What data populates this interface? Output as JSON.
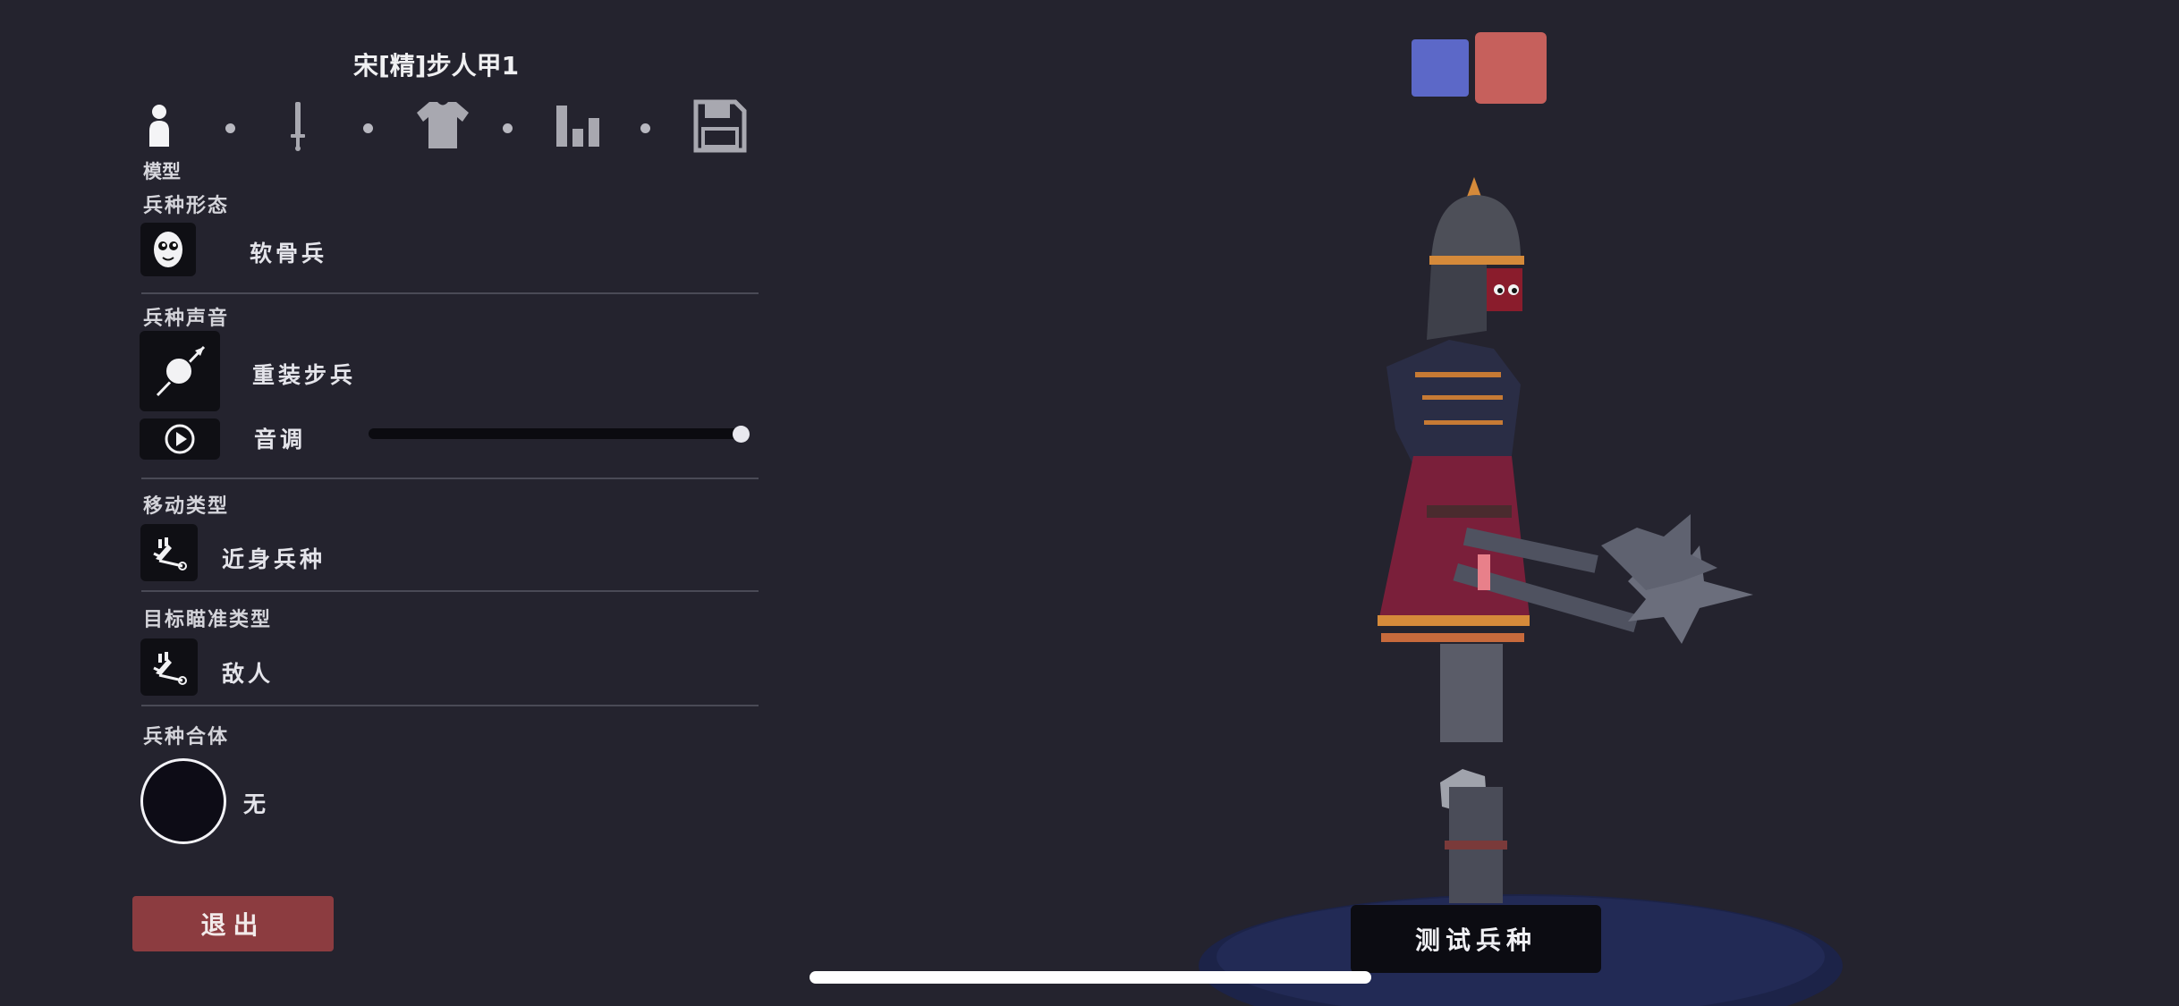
{
  "unit": {
    "name": "宋[精]步人甲1"
  },
  "tabs": {
    "items": [
      {
        "icon": "person-icon",
        "active": true
      },
      {
        "icon": "sword-icon",
        "active": false
      },
      {
        "icon": "shirt-icon",
        "active": false
      },
      {
        "icon": "stats-icon",
        "active": false
      },
      {
        "icon": "save-icon",
        "active": false
      }
    ],
    "active_label": "模型"
  },
  "sections": {
    "unit_form": {
      "title": "兵种形态",
      "icon": "ragdoll-face-icon",
      "value": "软骨兵"
    },
    "unit_voice": {
      "title": "兵种声音",
      "icon": "spear-shield-icon",
      "value": "重装步兵"
    },
    "pitch": {
      "icon": "play-icon",
      "label": "音调",
      "level": 1.0
    },
    "movement": {
      "title": "移动类型",
      "icon": "movement-icon",
      "value": "近身兵种"
    },
    "targeting": {
      "title": "目标瞄准类型",
      "icon": "target-icon",
      "value": "敌人"
    },
    "combination": {
      "title": "兵种合体",
      "value": "无"
    }
  },
  "buttons": {
    "exit": "退出",
    "test_unit": "测试兵种"
  },
  "team_colors": {
    "blue": "#5c68c8",
    "red": "#c6605c"
  },
  "colors": {
    "background": "#24232e",
    "exit_button": "#8c3c40"
  }
}
